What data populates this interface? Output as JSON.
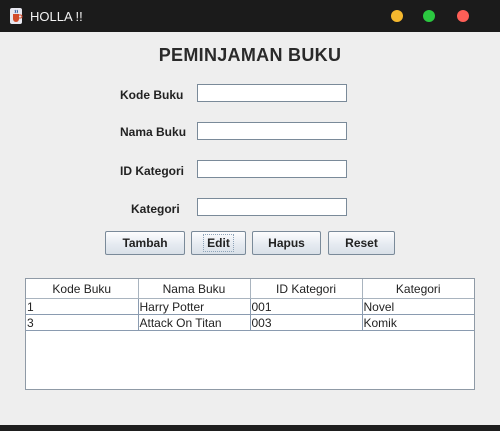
{
  "window": {
    "title": "HOLLA !!",
    "icon": "java-cup-icon",
    "controls": {
      "minimize_color": "#f5b82e",
      "maximize_color": "#2bc840",
      "close_color": "#fe5f57"
    }
  },
  "form": {
    "title": "PEMINJAMAN BUKU",
    "fields": [
      {
        "label": "Kode Buku",
        "value": ""
      },
      {
        "label": "Nama Buku",
        "value": ""
      },
      {
        "label": "ID Kategori",
        "value": ""
      },
      {
        "label": "Kategori",
        "value": ""
      }
    ],
    "buttons": {
      "add_label": "Tambah",
      "edit_label": "Edit",
      "delete_label": "Hapus",
      "reset_label": "Reset"
    }
  },
  "table": {
    "headers": [
      "Kode Buku",
      "Nama Buku",
      "ID Kategori",
      "Kategori"
    ],
    "rows": [
      [
        "1",
        "Harry Potter",
        "001",
        "Novel"
      ],
      [
        "3",
        "Attack On Titan",
        "003",
        "Komik"
      ]
    ]
  }
}
